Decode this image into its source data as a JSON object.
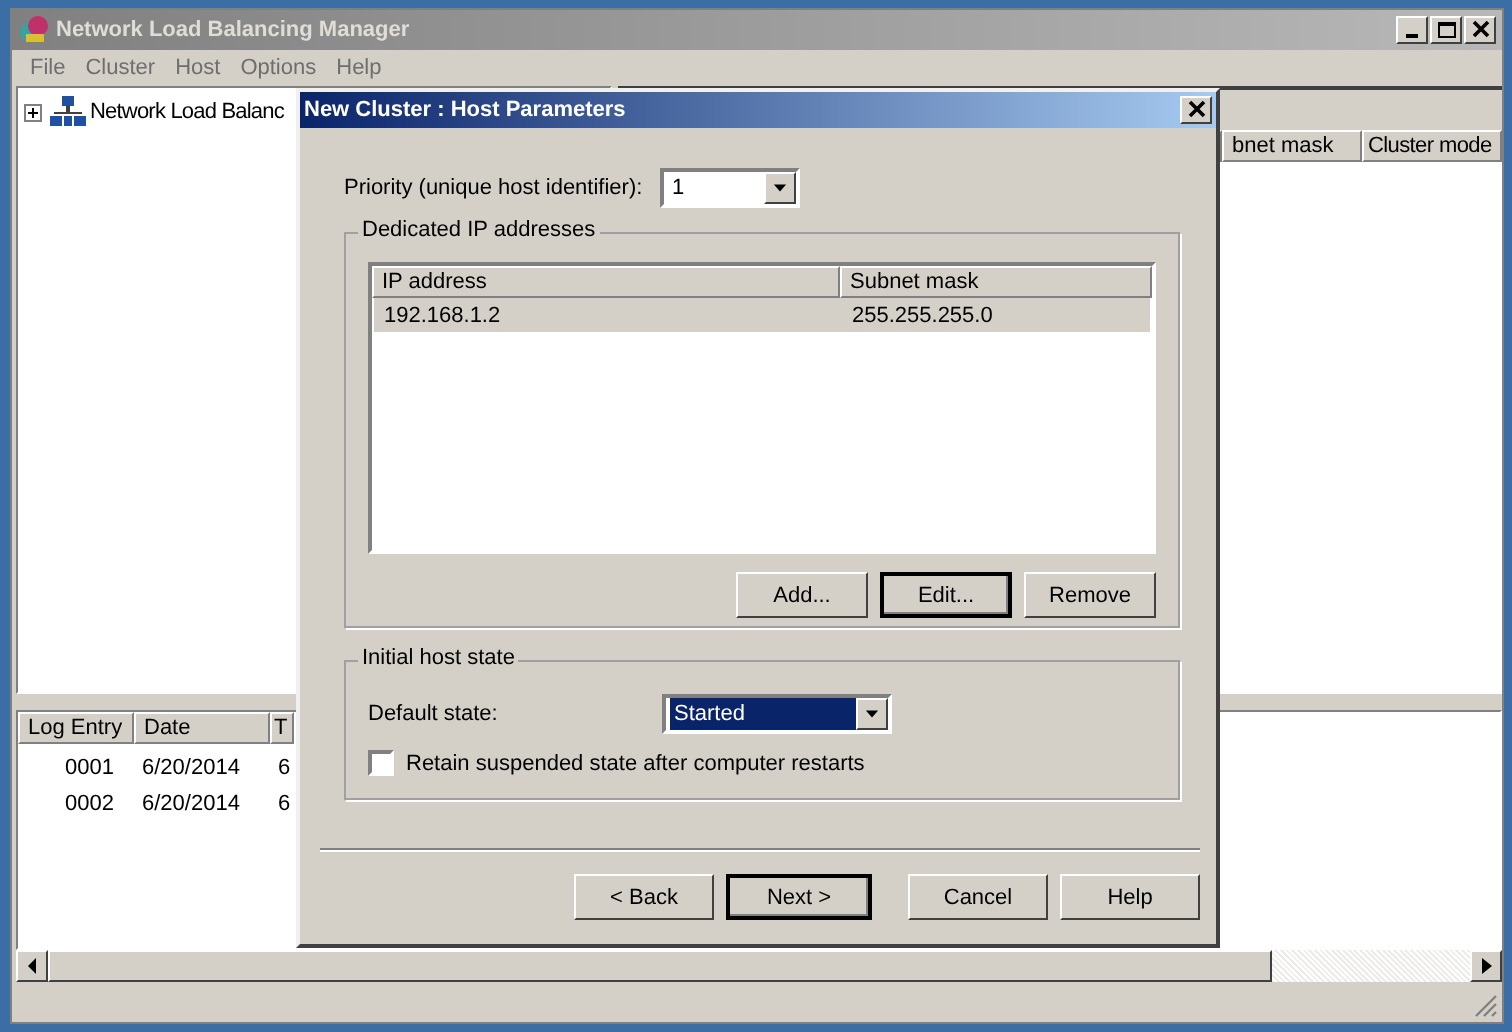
{
  "main_window": {
    "title": "Network Load Balancing Manager",
    "menu": [
      "File",
      "Cluster",
      "Host",
      "Options",
      "Help"
    ],
    "tree": [
      {
        "label": "Network Load Balanc",
        "expanded": false
      }
    ],
    "cluster_columns": [
      "bnet mask",
      "Cluster mode"
    ],
    "log_columns": [
      "Log Entry",
      "Date",
      "T"
    ],
    "log_rows": [
      [
        "0001",
        "6/20/2014",
        "6"
      ],
      [
        "0002",
        "6/20/2014",
        "6"
      ]
    ]
  },
  "dialog": {
    "title": "New Cluster : Host Parameters",
    "priority_label": "Priority (unique host identifier):",
    "priority_value": "1",
    "ip_group": "Dedicated IP addresses",
    "ip_columns": [
      "IP address",
      "Subnet mask"
    ],
    "ip_rows": [
      {
        "cells": [
          "192.168.1.2",
          "255.255.255.0"
        ],
        "selected": true
      }
    ],
    "ip_buttons": [
      {
        "label": "Add...",
        "focused": false
      },
      {
        "label": "Edit...",
        "focused": true
      },
      {
        "label": "Remove",
        "focused": false
      }
    ],
    "state_group": "Initial host state",
    "default_state_label": "Default state:",
    "default_state_value": "Started",
    "retain": {
      "label": "Retain suspended state after computer restarts",
      "checked": false
    },
    "buttons": [
      {
        "label": "< Back",
        "default": false
      },
      {
        "label": "Next >",
        "default": true
      },
      {
        "label": "Cancel",
        "default": false
      },
      {
        "label": "Help",
        "default": false
      }
    ]
  }
}
